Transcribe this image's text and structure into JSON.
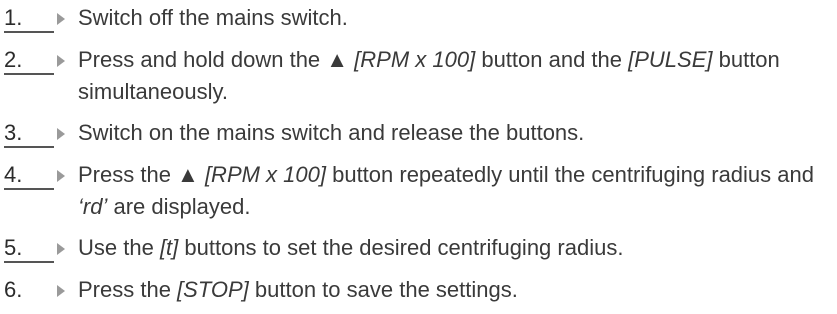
{
  "steps": [
    {
      "number": "1.",
      "segments": [
        {
          "text": "Switch off the mains switch.",
          "italic": false
        }
      ]
    },
    {
      "number": "2.",
      "segments": [
        {
          "text": "Press and hold down the ▲ ",
          "italic": false
        },
        {
          "text": "[RPM x 100]",
          "italic": true
        },
        {
          "text": " button and the ",
          "italic": false
        },
        {
          "text": "[PULSE]",
          "italic": true
        },
        {
          "text": " button simultaneously.",
          "italic": false
        }
      ]
    },
    {
      "number": "3.",
      "segments": [
        {
          "text": "Switch on the mains switch and release the buttons.",
          "italic": false
        }
      ]
    },
    {
      "number": "4.",
      "segments": [
        {
          "text": "Press the ▲ ",
          "italic": false
        },
        {
          "text": "[RPM x 100]",
          "italic": true
        },
        {
          "text": " button repeatedly until the centrifuging radius and ",
          "italic": false
        },
        {
          "text": "‘rd’",
          "italic": true
        },
        {
          "text": " are displayed.",
          "italic": false
        }
      ]
    },
    {
      "number": "5.",
      "segments": [
        {
          "text": "Use the ",
          "italic": false
        },
        {
          "text": "[t]",
          "italic": true
        },
        {
          "text": " buttons to set the desired centrifuging radius.",
          "italic": false
        }
      ]
    },
    {
      "number": "6.",
      "segments": [
        {
          "text": "Press the ",
          "italic": false
        },
        {
          "text": "[STOP]",
          "italic": true
        },
        {
          "text": " button to save the settings.",
          "italic": false
        }
      ]
    }
  ]
}
